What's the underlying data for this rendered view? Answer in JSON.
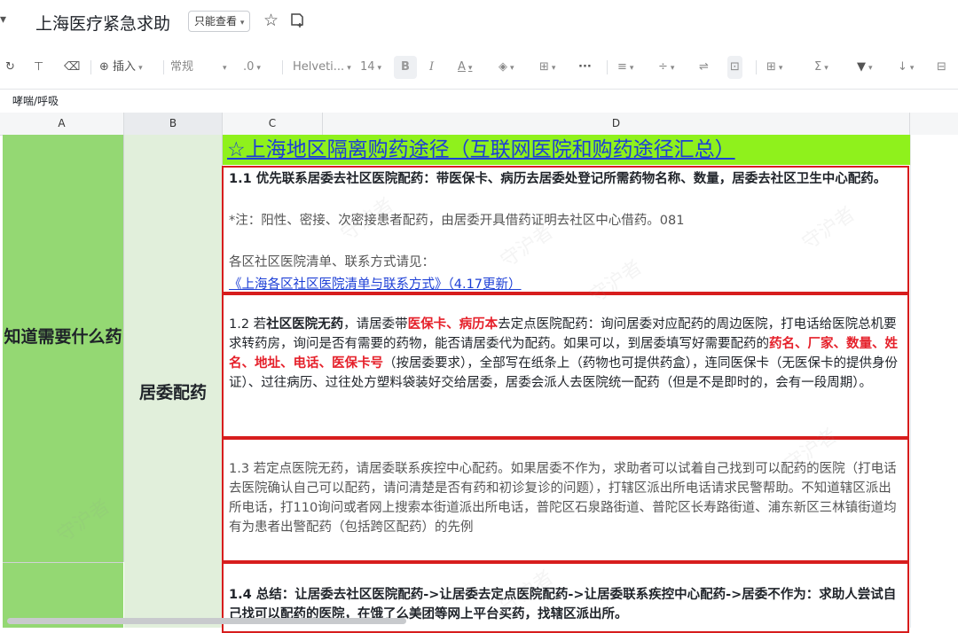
{
  "app": {
    "doc_title": "上海医疗紧急求助",
    "readonly_label": "只能查看",
    "title_caret": "▾"
  },
  "toolbar": {
    "insert_label": "插入",
    "format_label": "常规",
    "decimal_label": ".0",
    "font_label": "Helveti...",
    "size_label": "14",
    "bold_label": "B",
    "italic_label": "I",
    "underline_label": "A",
    "more_label": "···",
    "sigma_label": "Σ"
  },
  "formula_bar": {
    "value": "哮喘/呼吸"
  },
  "columns": [
    "A",
    "B",
    "C",
    "D"
  ],
  "cells": {
    "a_label": "知道需要什么药",
    "b_label": "居委配药",
    "header_link": "☆上海地区隔离购药途径（互联网医院和购药途径汇总）"
  },
  "box1": {
    "line1_bold": "1.1 优先联系居委去社区医院配药：带医保卡、病历去居委处登记所需药物名称、数量，居委去社区卫生中心配药。",
    "note": "*注：阳性、密接、次密接患者配药，由居委开具借药证明去社区中心借药。081",
    "list_label": "各区社区医院清单、联系方式请见：",
    "list_link": "《上海各区社区医院清单与联系方式》（4.17更新）"
  },
  "box2": {
    "t1": "1.2 若",
    "t2": "社区医院无药",
    "t3": "，请居委带",
    "t4": "医保卡、病历本",
    "t5": "去定点医院配药：询问居委对应配药的周边医院，打电话给医院总机要求转药房，询问是否有需要的药物，能否请居委代为配药。如果可以，到居委填写好需要配药的",
    "t6": "药名、厂家、数量、姓名、地址、电话、医保卡号",
    "t7": "（按居委要求），全部写在纸条上（药物也可提供药盒），连同医保卡（无医保卡的提供身份证）、过往病历、过往处方塑料袋装好交给居委，居委会派人去医院统一配药（但是不是即时的，会有一段周期）。"
  },
  "box3": {
    "text": "1.3 若定点医院无药，请居委联系疾控中心配药。如果居委不作为，求助者可以试着自己找到可以配药的医院（打电话去医院确认自己可以配药，请问清楚是否有药和初诊复诊的问题），打辖区派出所电话请求民警帮助。不知道辖区派出所电话，打110询问或者网上搜索本街道派出所电话，普陀区石泉路街道、普陀区长寿路街道、浦东新区三林镇街道均有为患者出警配药（包括跨区配药）的先例"
  },
  "box4": {
    "text": "1.4 总结：让居委去社区医院配药->让居委去定点医院配药->让居委联系疾控中心配药->居委不作为：求助人尝试自己找可以配药的医院，在饿了么美团等网上平台买药，找辖区派出所。"
  },
  "watermark": "守沪者",
  "colors": {
    "green_a": "#94d873",
    "green_b": "#e1efdb",
    "header_bg": "#8ff11c",
    "link": "#1d3fd6",
    "red": "#e5202a",
    "border_red": "#d71d1d"
  }
}
